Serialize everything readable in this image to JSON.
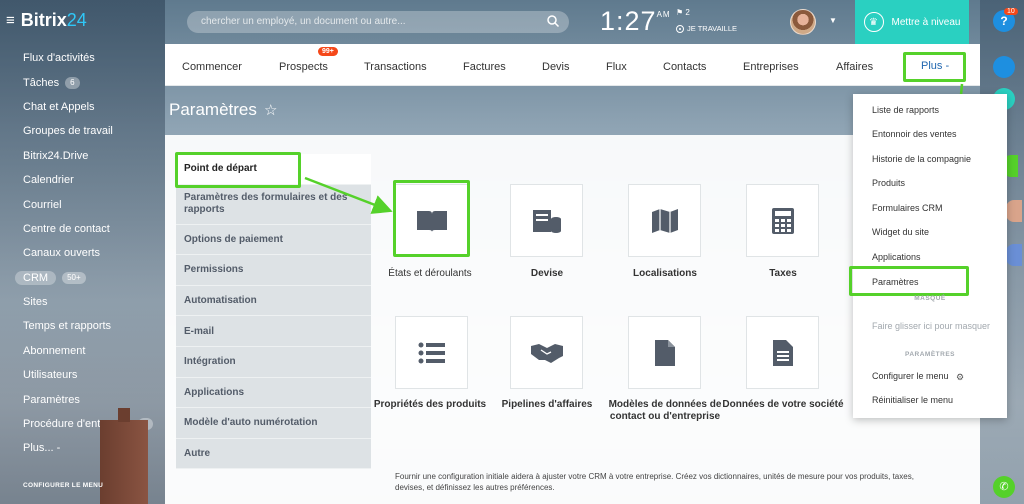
{
  "brand": {
    "name": "Bitrix",
    "suffix": "24"
  },
  "sidebar": {
    "items": [
      {
        "label": "Flux d'activités"
      },
      {
        "label": "Tâches",
        "count": "6"
      },
      {
        "label": "Chat et Appels"
      },
      {
        "label": "Groupes de travail"
      },
      {
        "label": "Bitrix24.Drive"
      },
      {
        "label": "Calendrier"
      },
      {
        "label": "Courriel"
      },
      {
        "label": "Centre de contact"
      },
      {
        "label": "Canaux ouverts"
      },
      {
        "label": "CRM",
        "count": "50+",
        "active": true
      },
      {
        "label": "Sites"
      },
      {
        "label": "Temps et rapports"
      },
      {
        "label": "Abonnement"
      },
      {
        "label": "Utilisateurs"
      },
      {
        "label": "Paramètres"
      },
      {
        "label": "Procédure d'entrepr...",
        "count": "2"
      },
      {
        "label": "Plus... -"
      }
    ],
    "configure_label": "CONFIGURER LE MENU"
  },
  "header": {
    "search_placeholder": "chercher un employé, un document ou autre...",
    "clock_time": "1:27",
    "clock_ampm": "AM",
    "flag_count": "2",
    "work_status": "JE TRAVAILLE",
    "upgrade_label": "Mettre à niveau",
    "notif_badge": "10"
  },
  "topnav": {
    "tabs": [
      "Commencer",
      "Prospects",
      "Transactions",
      "Factures",
      "Devis",
      "Flux",
      "Contacts",
      "Entreprises",
      "Affaires",
      "Plus -"
    ],
    "prospects_badge": "99+"
  },
  "page": {
    "title": "Paramètres"
  },
  "settings_menu": [
    "Point de départ",
    "Paramètres des formulaires et des rapports",
    "Options de paiement",
    "Permissions",
    "Automatisation",
    "E-mail",
    "Intégration",
    "Applications",
    "Modèle d'auto numérotation",
    "Autre"
  ],
  "tiles": [
    {
      "label": "États et déroulants",
      "icon": "book-icon"
    },
    {
      "label": "Devise",
      "icon": "coins-icon"
    },
    {
      "label": "Localisations",
      "icon": "map-icon"
    },
    {
      "label": "Taxes",
      "icon": "calculator-icon"
    },
    {
      "label": "Propriétés des produits",
      "icon": "list-icon"
    },
    {
      "label": "Pipelines d'affaires",
      "icon": "handshake-icon"
    },
    {
      "label": "Modèles de données de contact ou d'entreprise",
      "icon": "document-icon"
    },
    {
      "label": "Données de votre société",
      "icon": "document-lines-icon"
    }
  ],
  "footnote": "Fournir une configuration initiale aidera à ajuster votre CRM à votre entreprise. Créez vos dictionnaires, unités de mesure pour vos produits, taxes, devises, et définissez les autres préférences.",
  "dropdown": {
    "items": [
      "Liste de rapports",
      "Entonnoir des ventes",
      "Historie de la compagnie",
      "Produits",
      "Formulaires CRM",
      "Widget du site",
      "Applications",
      "Paramètres"
    ],
    "hidden_header": "MASQUÉ",
    "drag_hint": "Faire glisser ici pour masquer",
    "settings_header": "PARAMÈTRES",
    "configure_menu": "Configurer le menu",
    "reset_menu": "Réinitialiser le menu"
  },
  "colors": {
    "highlight": "#55d12a",
    "accent": "#2ad0c1",
    "badge": "#f54819",
    "link": "#2067b0"
  }
}
